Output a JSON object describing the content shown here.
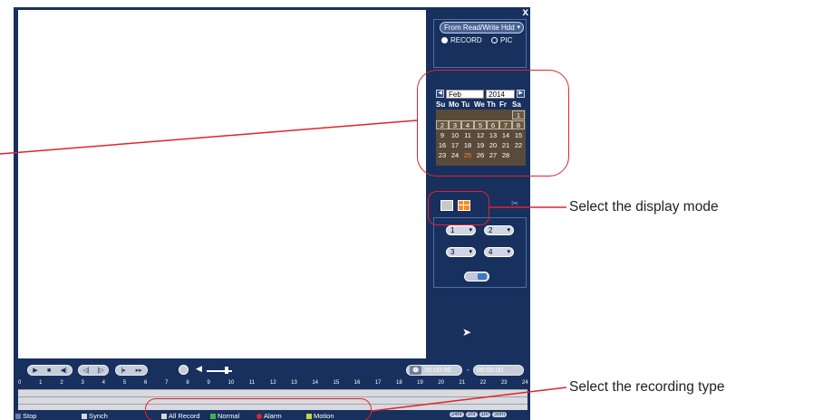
{
  "window": {
    "close_label": "x"
  },
  "source": {
    "select_value": "From Read/Write Hdd",
    "options": [
      {
        "label": "RECORD",
        "selected": true
      },
      {
        "label": "PIC",
        "selected": false
      }
    ]
  },
  "calendar": {
    "prev_icon": "chevron-left-icon",
    "next_icon": "chevron-right-icon",
    "month": "Feb",
    "year": "2014",
    "weekdays": [
      "Su",
      "Mo",
      "Tu",
      "We",
      "Th",
      "Fr",
      "Sa"
    ],
    "days": [
      {
        "d": "",
        "has": false
      },
      {
        "d": "",
        "has": false
      },
      {
        "d": "",
        "has": false
      },
      {
        "d": "",
        "has": false
      },
      {
        "d": "",
        "has": false
      },
      {
        "d": "",
        "has": false
      },
      {
        "d": "1",
        "has": true
      },
      {
        "d": "2",
        "has": true
      },
      {
        "d": "3",
        "has": true
      },
      {
        "d": "4",
        "has": true
      },
      {
        "d": "5",
        "has": true
      },
      {
        "d": "6",
        "has": true
      },
      {
        "d": "7",
        "has": true
      },
      {
        "d": "8",
        "has": true
      },
      {
        "d": "9",
        "has": false
      },
      {
        "d": "10",
        "has": false
      },
      {
        "d": "11",
        "has": false
      },
      {
        "d": "12",
        "has": false
      },
      {
        "d": "13",
        "has": false
      },
      {
        "d": "14",
        "has": false
      },
      {
        "d": "15",
        "has": false
      },
      {
        "d": "16",
        "has": false
      },
      {
        "d": "17",
        "has": false
      },
      {
        "d": "18",
        "has": false
      },
      {
        "d": "19",
        "has": false
      },
      {
        "d": "20",
        "has": false
      },
      {
        "d": "21",
        "has": false
      },
      {
        "d": "22",
        "has": false
      },
      {
        "d": "23",
        "has": false
      },
      {
        "d": "24",
        "has": false
      },
      {
        "d": "25",
        "has": false,
        "today": true
      },
      {
        "d": "26",
        "has": false
      },
      {
        "d": "27",
        "has": false
      },
      {
        "d": "28",
        "has": false
      },
      {
        "d": "",
        "has": false
      }
    ]
  },
  "display_mode": {
    "active": "quad",
    "modes": [
      "single",
      "quad"
    ]
  },
  "channels": [
    "1",
    "2",
    "3",
    "4"
  ],
  "playback": {
    "buttons": [
      "play",
      "stop",
      "step-back",
      "slow",
      "fast",
      "next-frame",
      "last"
    ],
    "time_start": "00:00:00",
    "time_end": "00:00:00"
  },
  "timeline": {
    "hours": [
      "0",
      "1",
      "2",
      "3",
      "4",
      "5",
      "6",
      "7",
      "8",
      "9",
      "10",
      "11",
      "12",
      "13",
      "14",
      "15",
      "16",
      "17",
      "18",
      "19",
      "20",
      "21",
      "22",
      "23",
      "24"
    ]
  },
  "status_bar": {
    "stop": "Stop",
    "synch": "Synch",
    "types": [
      {
        "label": "All Record",
        "color": "#d8d8d8"
      },
      {
        "label": "Normal",
        "color": "#3bb54a"
      },
      {
        "label": "Alarm",
        "color": "#e0242b"
      },
      {
        "label": "Motion",
        "color": "#c8d63a"
      }
    ],
    "zoom": [
      "24hr",
      "2hr",
      "1hr",
      "30m"
    ]
  },
  "annotations": {
    "display_mode": "Select the display mode",
    "recording_type": "Select the recording type",
    "ring_color": "#e0242b"
  }
}
